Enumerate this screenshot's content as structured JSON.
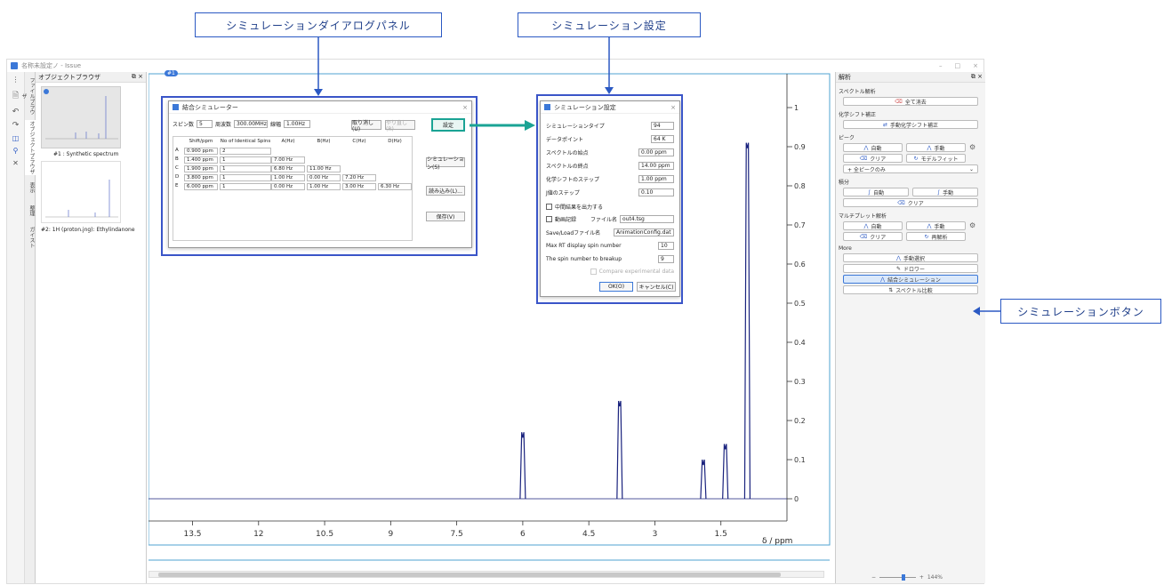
{
  "callouts": {
    "dialog_panel": "シミュレーションダイアログパネル",
    "sim_settings": "シミュレーション設定",
    "sim_button": "シミュレーションボタン"
  },
  "app": {
    "title": "名称未設定ノ - Issue",
    "window_controls": [
      "–",
      "□",
      "×"
    ]
  },
  "side_tabs": [
    "ファイルブラウザ",
    "オブジェクトブラウザ",
    "表示",
    "整理",
    "ガイスト"
  ],
  "browser": {
    "header": "オブジェクトブラウザ",
    "header_icons": "⧉ ×",
    "items": [
      {
        "label": "#1 : Synthetic spectrum"
      },
      {
        "label": "#2: 1H (proton.jng): Ethylindanone"
      }
    ]
  },
  "plot": {
    "x_ticks": [
      "13.5",
      "12",
      "10.5",
      "9",
      "7.5",
      "6",
      "4.5",
      "3",
      "1.5"
    ],
    "x_label": "δ / ppm",
    "y_ticks": [
      "1",
      "0.9",
      "0.8",
      "0.7",
      "0.6",
      "0.5",
      "0.4",
      "0.3",
      "0.2",
      "0.1",
      "0"
    ],
    "tab_label": "#1"
  },
  "chart_data": {
    "type": "line",
    "xlabel": "δ / ppm",
    "xlim": [
      14.5,
      0
    ],
    "ylim": [
      -0.03,
      1.05
    ],
    "peaks": [
      {
        "ppm": 6.0,
        "height": 0.17
      },
      {
        "ppm": 3.8,
        "height": 0.25
      },
      {
        "ppm": 1.9,
        "height": 0.1
      },
      {
        "ppm": 1.4,
        "height": 0.14
      },
      {
        "ppm": 0.9,
        "height": 0.91
      }
    ]
  },
  "right_panel": {
    "header": "解析",
    "header_icons": "⧉ ×",
    "sections": {
      "spectrum_analysis": "スペクトル解析",
      "all_labels": "全て消去",
      "chem_shift": "化学シフト補正",
      "manual_chem_shift": "手動化学シフト補正",
      "peaks": "ピーク",
      "auto": "自動",
      "manual": "手動",
      "clear": "クリア",
      "model_fit": "モデルフィット",
      "peak_filter": "+ 全ピークのみ",
      "integral": "積分",
      "multiplet": "マルチプレット解析",
      "reanalyze": "再解析",
      "more": "More",
      "manual_select": "手動選択",
      "draw": "ドロワー",
      "coupled_sim": "結合シミュレーション",
      "spectrum_compare": "スペクトル比較"
    }
  },
  "sim_dialog": {
    "title": "結合シミュレーター",
    "spin_label": "スピン数",
    "spin_value": "5",
    "freq_label": "周波数",
    "freq_value": "300.00MHz",
    "width_label": "線幅",
    "width_value": "1.00Hz",
    "undo": "取り消し(U)",
    "redo": "やり直し(R)",
    "settings": "設定",
    "headers": [
      "Shift/ppm",
      "No of Identical Spins",
      "A(Hz)",
      "B(Hz)",
      "C(Hz)",
      "D(Hz)"
    ],
    "rows": [
      {
        "id": "A",
        "shift": "0.900 ppm",
        "n": "2",
        "a": "",
        "b": "",
        "c": "",
        "d": ""
      },
      {
        "id": "B",
        "shift": "1.400 ppm",
        "n": "1",
        "a": "7.00 Hz",
        "b": "",
        "c": "",
        "d": ""
      },
      {
        "id": "C",
        "shift": "1.900 ppm",
        "n": "1",
        "a": "6.80 Hz",
        "b": "11.00 Hz",
        "c": "",
        "d": ""
      },
      {
        "id": "D",
        "shift": "3.800 ppm",
        "n": "1",
        "a": "1.00 Hz",
        "b": "0.00 Hz",
        "c": "7.20 Hz",
        "d": ""
      },
      {
        "id": "E",
        "shift": "6.000 ppm",
        "n": "1",
        "a": "0.00 Hz",
        "b": "1.00 Hz",
        "c": "3.00 Hz",
        "d": "6.30 Hz"
      }
    ],
    "simulate": "シミュレーション(S)",
    "load": "読み込み(L)...",
    "save": "保存(V)"
  },
  "settings_dialog": {
    "title": "シミュレーション設定",
    "fields": [
      {
        "label": "シミュレーションタイプ",
        "value": "94"
      },
      {
        "label": "データポイント",
        "value": "64 K"
      },
      {
        "label": "スペクトルの始点",
        "value": "0.00 ppm"
      },
      {
        "label": "スペクトルの終点",
        "value": "14.00 ppm"
      },
      {
        "label": "化学シフトのステップ",
        "value": "1.00 ppm"
      },
      {
        "label": "J値のステップ",
        "value": "0.10"
      }
    ],
    "intermediate": "中間結果を出力する",
    "anim_label": "動画記録",
    "anim_file_label": "ファイル名",
    "anim_file": "out4.tsg",
    "saveload_label": "Save/Loadファイル名",
    "saveload_value": "AnimationConfig.dat",
    "max_spin_label": "Max RT display spin number",
    "max_spin_value": "10",
    "breakup_label": "The spin number to breakup",
    "breakup_value": "9",
    "compare": "Compare experimental data",
    "ok": "OK(O)",
    "cancel": "キャンセル(C)"
  },
  "status": {
    "zoom": "144%"
  },
  "colors": {
    "accent": "#2b59c3",
    "spectrum": "#1a237e",
    "highlight": "#1aa394"
  }
}
